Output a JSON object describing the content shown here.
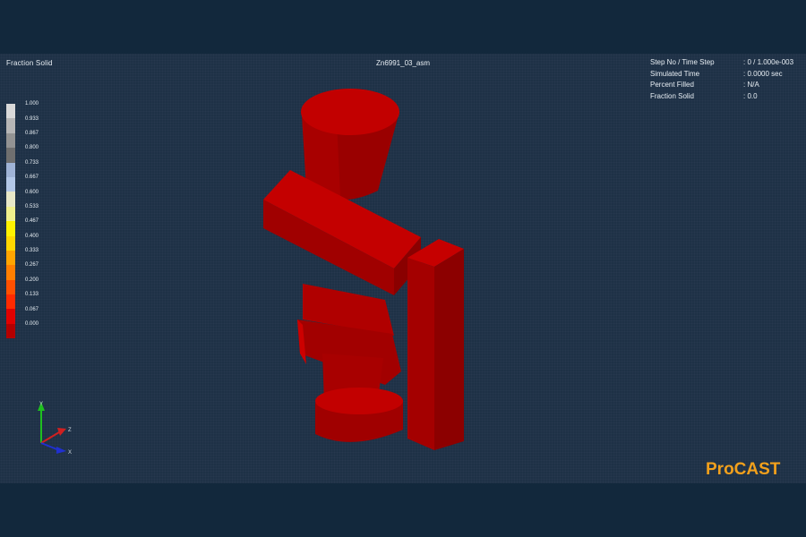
{
  "header": {
    "result_label": "Fraction Solid",
    "model_name": "Zn6991_03_asm"
  },
  "info_panel": [
    {
      "key": "Step No / Time Step",
      "value": ": 0 / 1.000e-003"
    },
    {
      "key": "Simulated Time",
      "value": ": 0.0000 sec"
    },
    {
      "key": "Percent Filled",
      "value": ": N/A"
    },
    {
      "key": "Fraction Solid",
      "value": ": 0.0"
    }
  ],
  "legend": {
    "labels": [
      "1.000",
      "0.933",
      "0.867",
      "0.800",
      "0.733",
      "0.667",
      "0.600",
      "0.533",
      "0.467",
      "0.400",
      "0.333",
      "0.267",
      "0.200",
      "0.133",
      "0.067",
      "0.000"
    ],
    "colors": [
      "#d9d9d9",
      "#b6b6b6",
      "#939393",
      "#6f6f6f",
      "#9fb3d6",
      "#b3c8e8",
      "#e8e8c8",
      "#f0f08c",
      "#fff200",
      "#ffd700",
      "#ffa500",
      "#ff7f00",
      "#ff5000",
      "#ff2a00",
      "#e00000",
      "#b30000"
    ]
  },
  "axes": {
    "y_label": "Y",
    "z_label": "Z",
    "x_label": "X"
  },
  "brand": "ProCAST",
  "model_color": "#b80000"
}
